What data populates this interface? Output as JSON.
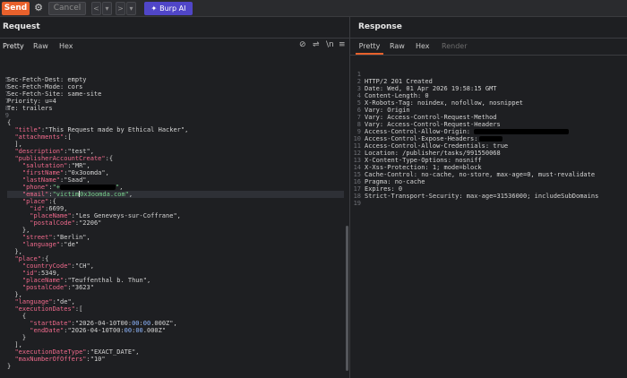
{
  "toolbar": {
    "send_label": "Send",
    "cancel_label": "Cancel",
    "burp_ai_label": "Burp AI",
    "burp_ai_icon": "sparkle-icon"
  },
  "request": {
    "title": "Request",
    "tabs": [
      "Pretty",
      "Raw",
      "Hex"
    ],
    "ln_label": "\\n",
    "lines": [
      {
        "n": "",
        "t": "Sec-Fetch-Dest: empty"
      },
      {
        "n": "5",
        "t": "Sec-Fetch-Mode: cors"
      },
      {
        "n": "6",
        "t": "Sec-Fetch-Site: same-site"
      },
      {
        "n": "7",
        "t": "Priority: u=4"
      },
      {
        "n": "7",
        "t": "Te: trailers"
      },
      {
        "n": "8",
        "t": ""
      },
      {
        "n": "9",
        "t": "{"
      },
      {
        "n": "",
        "t": "  \"title\":\"This Request made by Ethical Hacker\","
      },
      {
        "n": "",
        "t": "  \"attachments\":["
      },
      {
        "n": "",
        "t": "  ],"
      },
      {
        "n": "",
        "t": "  \"description\":\"test\","
      },
      {
        "n": "",
        "t": "  \"publisherAccountCreate\":{"
      },
      {
        "n": "",
        "t": "    \"salutation\":\"MR\","
      },
      {
        "n": "",
        "t": "    \"firstName\":\"0x3oomda\","
      },
      {
        "n": "",
        "t": "    \"lastName\":\"Saad\","
      },
      {
        "n": "",
        "t": "    \"phone\":\"+"
      },
      {
        "n": "",
        "t": "    \"email\":\"victim0x3oomda.com\","
      },
      {
        "n": "",
        "t": "    \"place\":{"
      },
      {
        "n": "",
        "t": "      \"id\":6699,"
      },
      {
        "n": "",
        "t": "      \"placeName\":\"Les Geneveys-sur-Coffrane\","
      },
      {
        "n": "",
        "t": "      \"postalCode\":\"2206\""
      },
      {
        "n": "",
        "t": "    },"
      },
      {
        "n": "",
        "t": "    \"street\":\"Berlin\","
      },
      {
        "n": "",
        "t": "    \"language\":\"de\""
      },
      {
        "n": "",
        "t": "  },"
      },
      {
        "n": "",
        "t": "  \"place\":{"
      },
      {
        "n": "",
        "t": "    \"countryCode\":\"CH\","
      },
      {
        "n": "",
        "t": "    \"id\":5349,"
      },
      {
        "n": "",
        "t": "    \"placeName\":\"Teuffenthal b. Thun\","
      },
      {
        "n": "",
        "t": "    \"postalCode\":\"3623\""
      },
      {
        "n": "",
        "t": "  },"
      },
      {
        "n": "",
        "t": "  \"language\":\"de\","
      },
      {
        "n": "",
        "t": "  \"executionDates\":["
      },
      {
        "n": "",
        "t": "    {"
      },
      {
        "n": "",
        "t": "      \"startDate\":\"2026-04-10T00:00:00.000Z\","
      },
      {
        "n": "",
        "t": "      \"endDate\":\"2026-04-10T00:00:00.000Z\""
      },
      {
        "n": "",
        "t": "    }"
      },
      {
        "n": "",
        "t": "  ],"
      },
      {
        "n": "",
        "t": "  \"executionDateType\":\"EXACT_DATE\","
      },
      {
        "n": "",
        "t": "  \"maxNumberOfOffers\":\"10\""
      },
      {
        "n": "",
        "t": "}"
      }
    ]
  },
  "response": {
    "title": "Response",
    "tabs": [
      "Pretty",
      "Raw",
      "Hex",
      "Render"
    ],
    "lines": [
      {
        "n": "1",
        "t": "HTTP/2 201 Created"
      },
      {
        "n": "2",
        "t": "Date: Wed, 01 Apr 2026 19:58:15 GMT"
      },
      {
        "n": "3",
        "t": "Content-Length: 0"
      },
      {
        "n": "4",
        "t": "X-Robots-Tag: noindex, nofollow, nosnippet"
      },
      {
        "n": "5",
        "t": "Vary: Origin"
      },
      {
        "n": "6",
        "t": "Vary: Access-Control-Request-Method"
      },
      {
        "n": "7",
        "t": "Vary: Access-Control-Request-Headers"
      },
      {
        "n": "8",
        "t": "Access-Control-Allow-Origin:"
      },
      {
        "n": "9",
        "t": "Access-Control-Expose-Headers:"
      },
      {
        "n": "10",
        "t": "Access-Control-Allow-Credentials: true"
      },
      {
        "n": "11",
        "t": "Location: /publisher/tasks/991550068"
      },
      {
        "n": "12",
        "t": "X-Content-Type-Options: nosniff"
      },
      {
        "n": "13",
        "t": "X-Xss-Protection: 1; mode=block"
      },
      {
        "n": "14",
        "t": "Cache-Control: no-cache, no-store, max-age=0, must-revalidate"
      },
      {
        "n": "15",
        "t": "Pragma: no-cache"
      },
      {
        "n": "16",
        "t": "Expires: 0"
      },
      {
        "n": "17",
        "t": "Strict-Transport-Security: max-age=31536000; includeSubDomains"
      },
      {
        "n": "18",
        "t": ""
      },
      {
        "n": "19",
        "t": ""
      }
    ]
  },
  "colors": {
    "accent": "#e8612c",
    "burp_ai": "#5046c8",
    "json_key": "#f06a8c",
    "json_string": "#78d18d",
    "json_number": "#8fb7ff"
  }
}
